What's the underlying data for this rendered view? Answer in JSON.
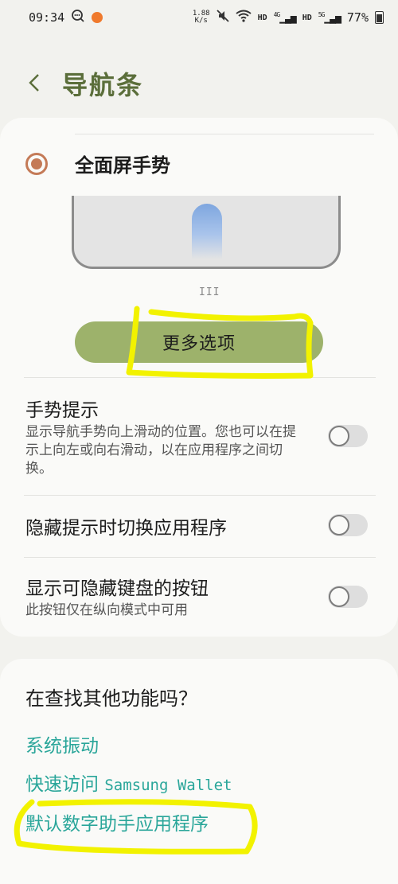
{
  "status": {
    "time": "09:34",
    "speed_top": "1.88",
    "speed_bottom": "K/s",
    "hd1": "HD",
    "net1": "4G",
    "hd2": "HD",
    "net2": "5G",
    "battery": "77%"
  },
  "header": {
    "title": "导航条"
  },
  "gesture": {
    "option_label": "全面屏手势",
    "selected": true,
    "handle_glyph": "III",
    "more_options_label": "更多选项"
  },
  "settings": [
    {
      "title": "手势提示",
      "desc": "显示导航手势向上滑动的位置。您也可以在提示上向左或向右滑动，以在应用程序之间切换。",
      "enabled": false
    },
    {
      "title": "隐藏提示时切换应用程序",
      "desc": "",
      "enabled": false
    },
    {
      "title": "显示可隐藏键盘的按钮",
      "desc": "此按钮仅在纵向模式中可用",
      "enabled": false
    }
  ],
  "suggestions": {
    "heading": "在查找其他功能吗？",
    "links": [
      "系统振动",
      "快速访问 ",
      "默认数字助手应用程序"
    ],
    "wallet": "Samsung Wallet"
  },
  "colors": {
    "accent_green": "#5b6e3a",
    "button_green": "#9db26b",
    "radio_color": "#c47a57",
    "link_teal": "#2aa69a",
    "highlight_yellow": "#f2f200"
  },
  "icons": {
    "back": "chevron-left-icon",
    "wifi": "wifi-icon",
    "mute": "mute-icon",
    "chat": "chat-bubble-icon"
  }
}
